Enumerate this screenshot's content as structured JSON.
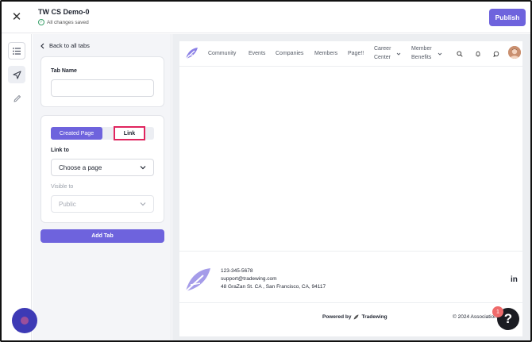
{
  "topbar": {
    "title": "TW CS Demo-0",
    "status": "All changes saved",
    "publish_label": "Publish"
  },
  "rail": {
    "icons": [
      "list-icon",
      "navigation-icon",
      "pencil-icon"
    ]
  },
  "panel": {
    "back_label": "Back to all tabs",
    "tab_name_label": "Tab Name",
    "tab_name_value": "",
    "segment": {
      "option_a": "Created Page",
      "option_b": "Link"
    },
    "link_to_label": "Link to",
    "link_to_value": "Choose a page",
    "visible_to_label": "Visible to",
    "visible_to_value": "Public",
    "add_tab_label": "Add Tab"
  },
  "preview": {
    "nav": {
      "community": "Community",
      "events": "Events",
      "companies": "Companies",
      "members": "Members",
      "page": "Page!!",
      "career_1": "Career",
      "career_2": "Center",
      "benefits_1": "Member",
      "benefits_2": "Benefits"
    },
    "footer": {
      "phone": "123-345-5678",
      "email": "support@tradewing.com",
      "address": "48 GraZan St. CA , San Francisco, CA, 94117",
      "powered_by": "Powered by",
      "brand": "Tradewing",
      "copyright": "© 2024 Association",
      "linkedin": "in"
    }
  },
  "help": {
    "label": "?",
    "badge": "1"
  },
  "colors": {
    "accent": "#6e63dd",
    "highlight": "#e0245e",
    "badge": "#ef6b6b"
  }
}
